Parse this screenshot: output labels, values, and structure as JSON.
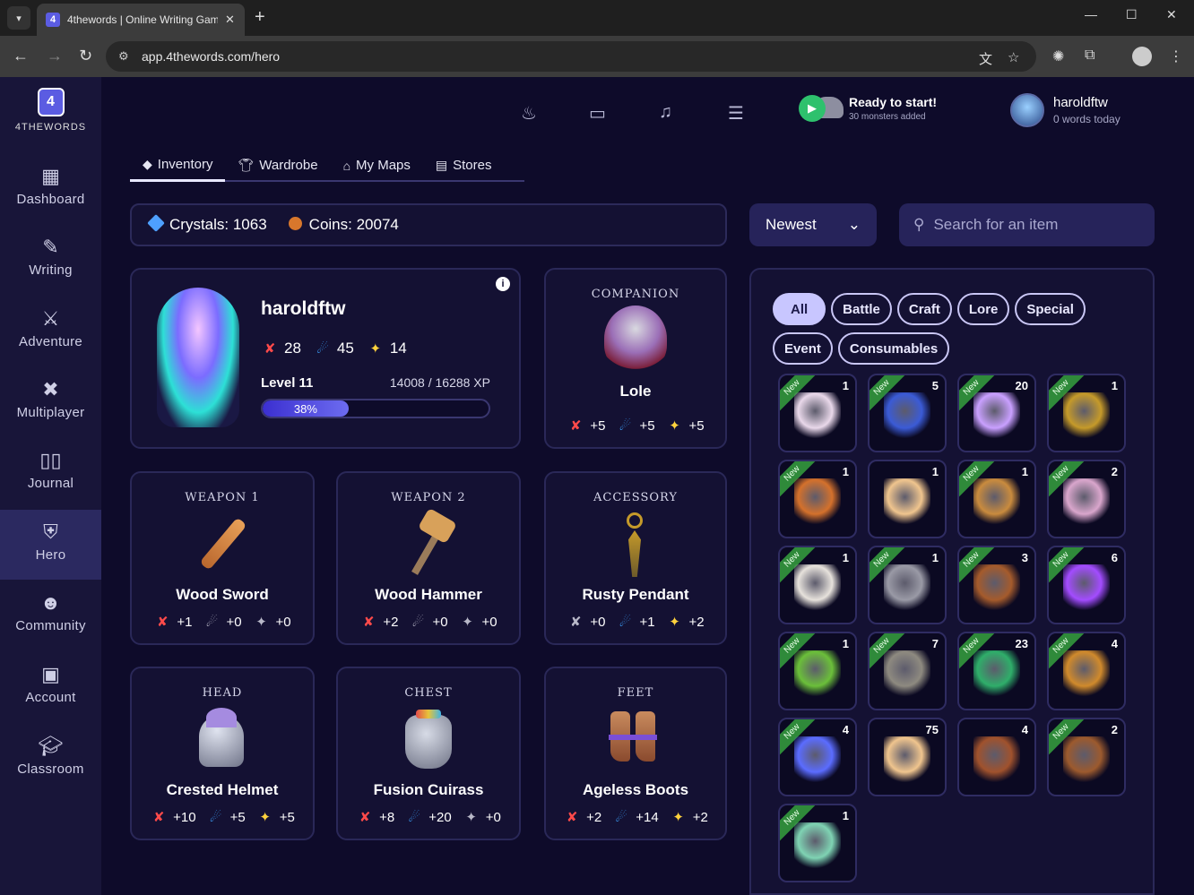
{
  "browser": {
    "tab_title": "4thewords | Online Writing Gam",
    "url": "app.4thewords.com/hero"
  },
  "sidebar": {
    "logo_text": "4THEWORDS",
    "items": [
      {
        "label": "Dashboard",
        "icon": "dashboard-icon"
      },
      {
        "label": "Writing",
        "icon": "writing-icon"
      },
      {
        "label": "Adventure",
        "icon": "adventure-icon"
      },
      {
        "label": "Multiplayer",
        "icon": "multiplayer-icon"
      },
      {
        "label": "Journal",
        "icon": "journal-icon"
      },
      {
        "label": "Hero",
        "icon": "hero-icon"
      },
      {
        "label": "Community",
        "icon": "community-icon"
      },
      {
        "label": "Account",
        "icon": "account-icon"
      },
      {
        "label": "Classroom",
        "icon": "classroom-icon"
      }
    ]
  },
  "topbar": {
    "ready_title": "Ready to start!",
    "ready_sub": "30 monsters added",
    "username": "haroldftw",
    "words_today": "0 words today"
  },
  "tabs": [
    "Inventory",
    "Wardrobe",
    "My Maps",
    "Stores"
  ],
  "currency": {
    "crystals": "Crystals: 1063",
    "coins": "Coins: 20074"
  },
  "sort": {
    "value": "Newest"
  },
  "search": {
    "placeholder": "Search for an item"
  },
  "hero": {
    "name": "haroldftw",
    "attack": "28",
    "defense": "45",
    "luck": "14",
    "level": "Level 11",
    "xp": "14008 / 16288 XP",
    "progress_pct": "38%",
    "progress": 0.38
  },
  "companion": {
    "header": "COMPANION",
    "name": "Lole",
    "atk": "+5",
    "def": "+5",
    "luck": "+5"
  },
  "equipment": [
    {
      "header": "WEAPON 1",
      "name": "Wood Sword",
      "atk": "+1",
      "def": "+0",
      "luck": "+0"
    },
    {
      "header": "WEAPON 2",
      "name": "Wood Hammer",
      "atk": "+2",
      "def": "+0",
      "luck": "+0"
    },
    {
      "header": "ACCESSORY",
      "name": "Rusty Pendant",
      "atk": "+0",
      "def": "+1",
      "luck": "+2"
    },
    {
      "header": "HEAD",
      "name": "Crested Helmet",
      "atk": "+10",
      "def": "+5",
      "luck": "+5"
    },
    {
      "header": "CHEST",
      "name": "Fusion Cuirass",
      "atk": "+8",
      "def": "+20",
      "luck": "+0"
    },
    {
      "header": "FEET",
      "name": "Ageless Boots",
      "atk": "+2",
      "def": "+14",
      "luck": "+2"
    }
  ],
  "filters": [
    "All",
    "Battle",
    "Craft",
    "Lore",
    "Special",
    "Event",
    "Consumables"
  ],
  "new_label": "New",
  "inventory": [
    {
      "qty": "1",
      "is_new": true,
      "color": "#e9d8ea"
    },
    {
      "qty": "5",
      "is_new": true,
      "color": "#3b5bd6"
    },
    {
      "qty": "20",
      "is_new": true,
      "color": "#c9a0ff"
    },
    {
      "qty": "1",
      "is_new": true,
      "color": "#c59a2a"
    },
    {
      "qty": "1",
      "is_new": true,
      "color": "#d4712c"
    },
    {
      "qty": "1",
      "is_new": false,
      "color": "#f0c58e"
    },
    {
      "qty": "1",
      "is_new": true,
      "color": "#c98b3e"
    },
    {
      "qty": "2",
      "is_new": true,
      "color": "#d9a6cc"
    },
    {
      "qty": "1",
      "is_new": true,
      "color": "#e7e2dc"
    },
    {
      "qty": "1",
      "is_new": true,
      "color": "#9a9aa6"
    },
    {
      "qty": "3",
      "is_new": true,
      "color": "#a55b2c"
    },
    {
      "qty": "6",
      "is_new": true,
      "color": "#a34cff"
    },
    {
      "qty": "1",
      "is_new": true,
      "color": "#6bbf3a"
    },
    {
      "qty": "7",
      "is_new": true,
      "color": "#8e8a80"
    },
    {
      "qty": "23",
      "is_new": true,
      "color": "#2fae6a"
    },
    {
      "qty": "4",
      "is_new": true,
      "color": "#d08a2c"
    },
    {
      "qty": "4",
      "is_new": true,
      "color": "#5b6cff"
    },
    {
      "qty": "75",
      "is_new": false,
      "color": "#f0c58e"
    },
    {
      "qty": "4",
      "is_new": false,
      "color": "#a0522d"
    },
    {
      "qty": "2",
      "is_new": true,
      "color": "#9c5a2e"
    },
    {
      "qty": "1",
      "is_new": true,
      "color": "#7fd3b3"
    }
  ]
}
